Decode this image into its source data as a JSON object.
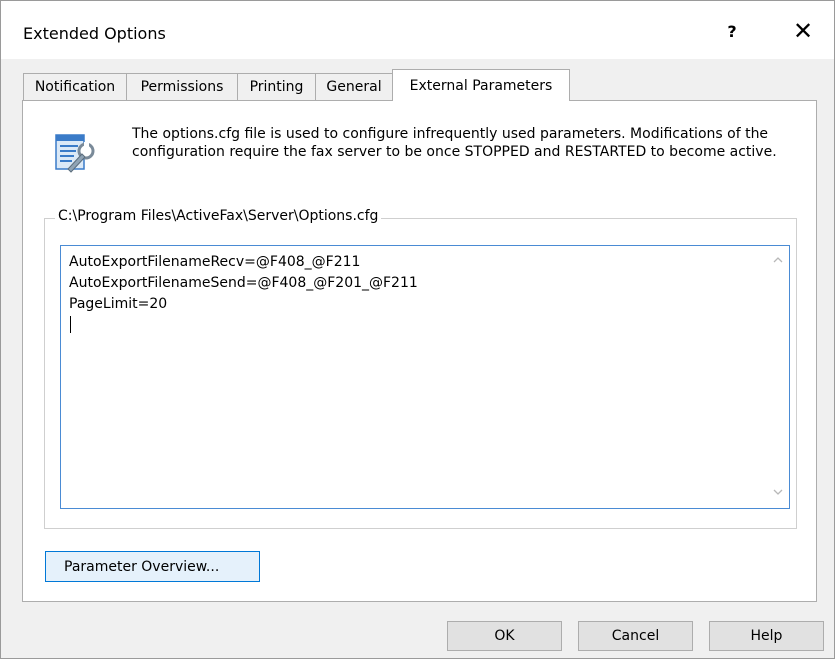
{
  "window": {
    "title": "Extended Options",
    "help_glyph": "?",
    "close_glyph": "✕"
  },
  "tabs": [
    {
      "label": "Notification",
      "active": false
    },
    {
      "label": "Permissions",
      "active": false
    },
    {
      "label": "Printing",
      "active": false
    },
    {
      "label": "General",
      "active": false
    },
    {
      "label": "External Parameters",
      "active": true
    }
  ],
  "panel": {
    "icon": "config-settings-icon",
    "description": "The options.cfg file is used to configure infrequently used parameters. Modifications of the configuration require the fax server to be once STOPPED and RESTARTED to become active.",
    "group_label": "C:\\Program Files\\ActiveFax\\Server\\Options.cfg",
    "editor_lines": [
      "AutoExportFilenameRecv=@F408_@F211",
      "AutoExportFilenameSend=@F408_@F201_@F211",
      "PageLimit=20"
    ],
    "overview_button": "Parameter Overview..."
  },
  "footer": {
    "ok": "OK",
    "cancel": "Cancel",
    "help": "Help"
  },
  "colors": {
    "accent": "#0078d7",
    "editor_border": "#4a8bd4"
  }
}
